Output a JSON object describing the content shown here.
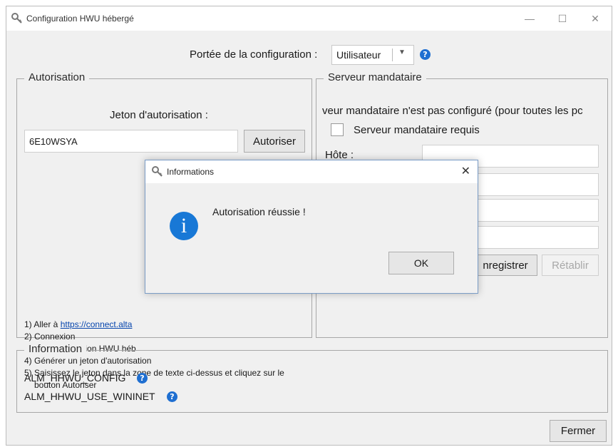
{
  "window": {
    "title": "Configuration HWU hébergé"
  },
  "scope": {
    "label": "Portée de la configuration :",
    "selected": "Utilisateur"
  },
  "auth": {
    "legend": "Autorisation",
    "token_label": "Jeton d'autorisation :",
    "token_value": "6E10WSYA",
    "authorize_button": "Autoriser",
    "steps": [
      {
        "prefix": "1) Aller à ",
        "link": "https://connect.alta"
      },
      {
        "text": "2) Connexion"
      },
      {
        "text": "3) Aller à la section HWU héb"
      },
      {
        "text": "4) Générer un jeton d'autorisation"
      },
      {
        "text": "5) Saisissez le jeton dans la zone de texte ci-dessus et cliquez sur le"
      },
      {
        "text": "bouton Autoriser"
      }
    ]
  },
  "proxy": {
    "legend": "Serveur mandataire",
    "status": "veur mandataire n'est pas configuré (pour toutes les pc",
    "required_label": "Serveur mandataire requis",
    "host_label": "Hôte :",
    "save_button": "nregistrer",
    "reset_button": "Rétablir"
  },
  "information": {
    "legend": "Information",
    "var1": "ALM_HHWU_CONFIG",
    "var2": "ALM_HHWU_USE_WININET"
  },
  "close_button": "Fermer",
  "dialog": {
    "title": "Informations",
    "message": "Autorisation réussie !",
    "ok_button": "OK"
  },
  "colors": {
    "accent": "#1f6fd1",
    "dialog_border": "#7a9cc6",
    "link": "#0645ad"
  }
}
